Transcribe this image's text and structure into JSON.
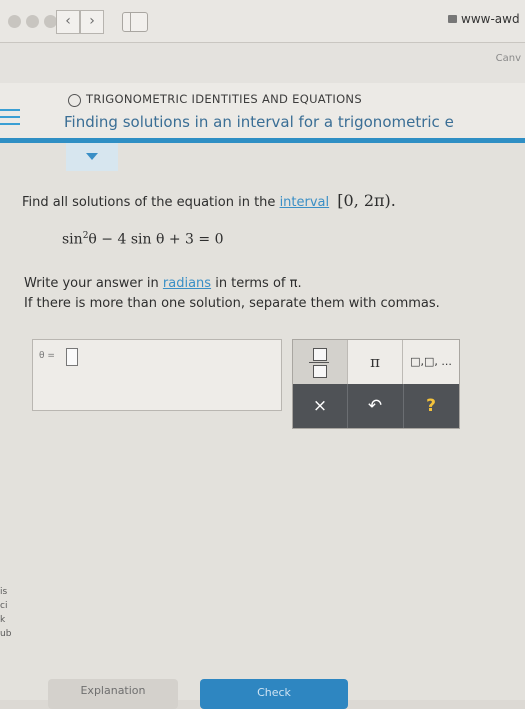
{
  "browser": {
    "url": "www-awd",
    "subbar_text": "Canv"
  },
  "topic": {
    "category": "TRIGONOMETRIC IDENTITIES AND EQUATIONS",
    "title": "Finding solutions in an interval for a trigonometric e"
  },
  "question": {
    "prompt": "Find all solutions of the equation in the",
    "interval_link": "interval",
    "interval_value": "[0, 2π).",
    "equation_prefix": "sin",
    "equation_exponent": "2",
    "equation_rest": "θ − 4 sin θ + 3 = 0",
    "instruction1_prefix": "Write your answer in",
    "instruction1_link": "radians",
    "instruction1_suffix": "in terms of π.",
    "instruction2": "If there is more than one solution, separate them with commas."
  },
  "answer": {
    "label": "θ ="
  },
  "keypad": {
    "pi": "π",
    "list": "□,□, ...",
    "clear": "×",
    "undo": "↶",
    "help": "?"
  },
  "edge_text": [
    "is",
    "ci",
    "k",
    "ub"
  ],
  "buttons": {
    "explanation": "Explanation",
    "check": "Check"
  },
  "colors": {
    "accent": "#2f8fc4",
    "link": "#3a8fc6",
    "keypad_dark": "#4f5256",
    "help": "#f5c33b"
  }
}
